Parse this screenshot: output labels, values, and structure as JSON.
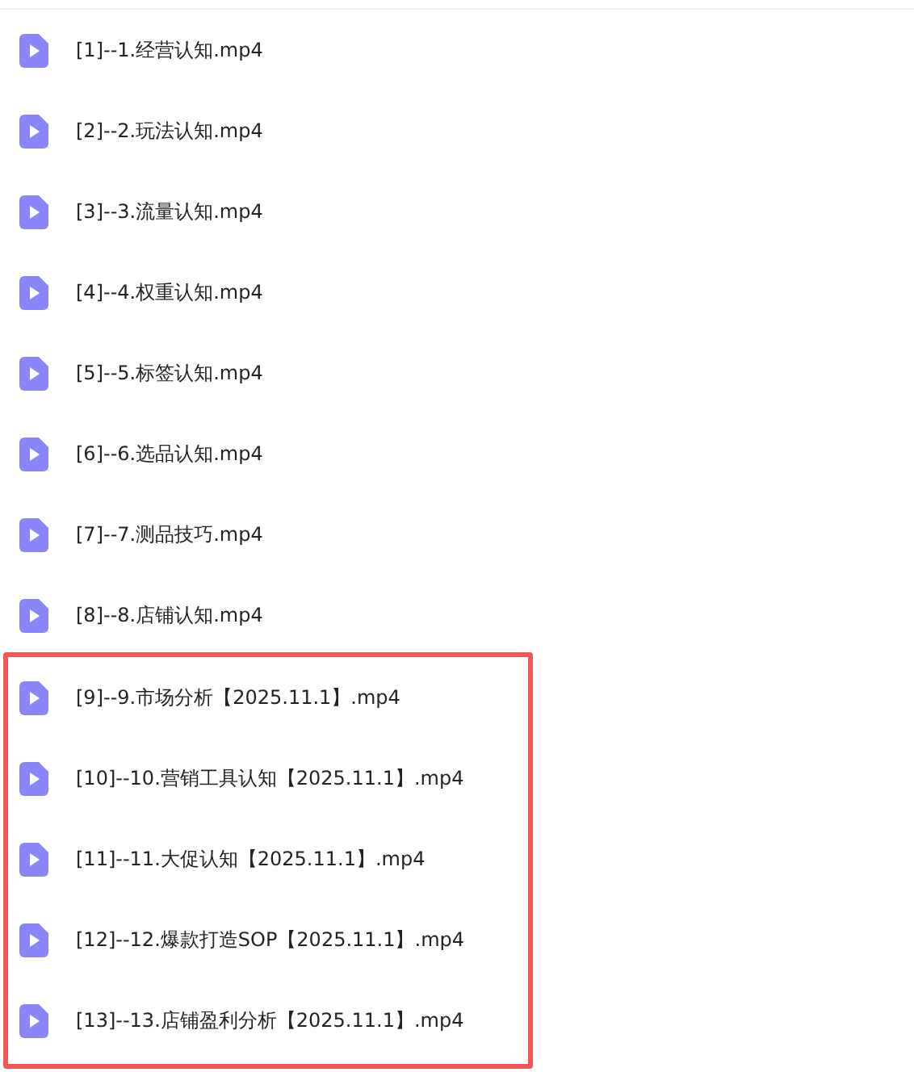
{
  "files": [
    {
      "name": "[1]--1.经营认知.mp4",
      "highlighted": false
    },
    {
      "name": "[2]--2.玩法认知.mp4",
      "highlighted": false
    },
    {
      "name": "[3]--3.流量认知.mp4",
      "highlighted": false
    },
    {
      "name": "[4]--4.权重认知.mp4",
      "highlighted": false
    },
    {
      "name": "[5]--5.标签认知.mp4",
      "highlighted": false
    },
    {
      "name": "[6]--6.选品认知.mp4",
      "highlighted": false
    },
    {
      "name": "[7]--7.测品技巧.mp4",
      "highlighted": false
    },
    {
      "name": "[8]--8.店铺认知.mp4",
      "highlighted": false
    },
    {
      "name": "[9]--9.市场分析【2025.11.1】.mp4",
      "highlighted": true
    },
    {
      "name": "[10]--10.营销工具认知【2025.11.1】.mp4",
      "highlighted": true
    },
    {
      "name": "[11]--11.大促认知【2025.11.1】.mp4",
      "highlighted": true
    },
    {
      "name": "[12]--12.爆款打造SOP【2025.11.1】.mp4",
      "highlighted": true
    },
    {
      "name": "[13]--13.店铺盈利分析【2025.11.1】.mp4",
      "highlighted": true
    }
  ]
}
